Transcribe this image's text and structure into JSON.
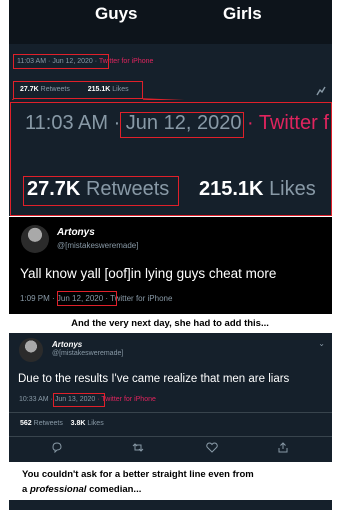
{
  "panel_top": {
    "poll_options": [
      "Guys",
      "Girls"
    ],
    "time": "11:03 AM",
    "dot": "·",
    "date": "Jun 12, 2020",
    "source": "Twitter for iPhone",
    "retweets_count": "27.7K",
    "retweets_label": "Retweets",
    "likes_count": "215.1K",
    "likes_label": "Likes",
    "analytics_icon": "analytics-icon"
  },
  "panel_zoom": {
    "time": "11:03 AM ·",
    "date": "Jun 12, 2020",
    "source": "· Twitter f",
    "retweets_count": "27.7K",
    "retweets_label": "Retweets",
    "likes_count": "215.1K",
    "likes_label": "Likes"
  },
  "tweet1": {
    "name": "Artonys",
    "handle": "@[mistakesweremade]",
    "text": "Yall know yall [oof]in lying guys cheat more",
    "time": "1:09 PM ·",
    "date": "Jun 12, 2020",
    "source": "· Twitter for iPhone"
  },
  "caption1": "And the very next day, she had to add this...",
  "tweet2": {
    "name": "Artonys",
    "handle": "@[mistakesweremade]",
    "text": "Due to the results I've came realize that men are liars",
    "time": "10:33 AM ·",
    "date": "Jun 13, 2020",
    "source": "· Twitter for iPhone",
    "retweets_count": "562",
    "retweets_label": "Retweets",
    "likes_count": "3.8K",
    "likes_label": "Likes",
    "actions": [
      "reply-icon",
      "retweet-icon",
      "like-icon",
      "share-icon"
    ]
  },
  "caption2": {
    "line1": "You couldn't ask for a better straight line even from",
    "line2_pre": "a",
    "line2_em": "professional",
    "line2_post": "comedian..."
  },
  "colors": {
    "dark_bg": "#15202b",
    "black_bg": "#000000",
    "accent_red": "#e0202a",
    "source_pink": "#e0245e",
    "muted": "#8899a6"
  }
}
